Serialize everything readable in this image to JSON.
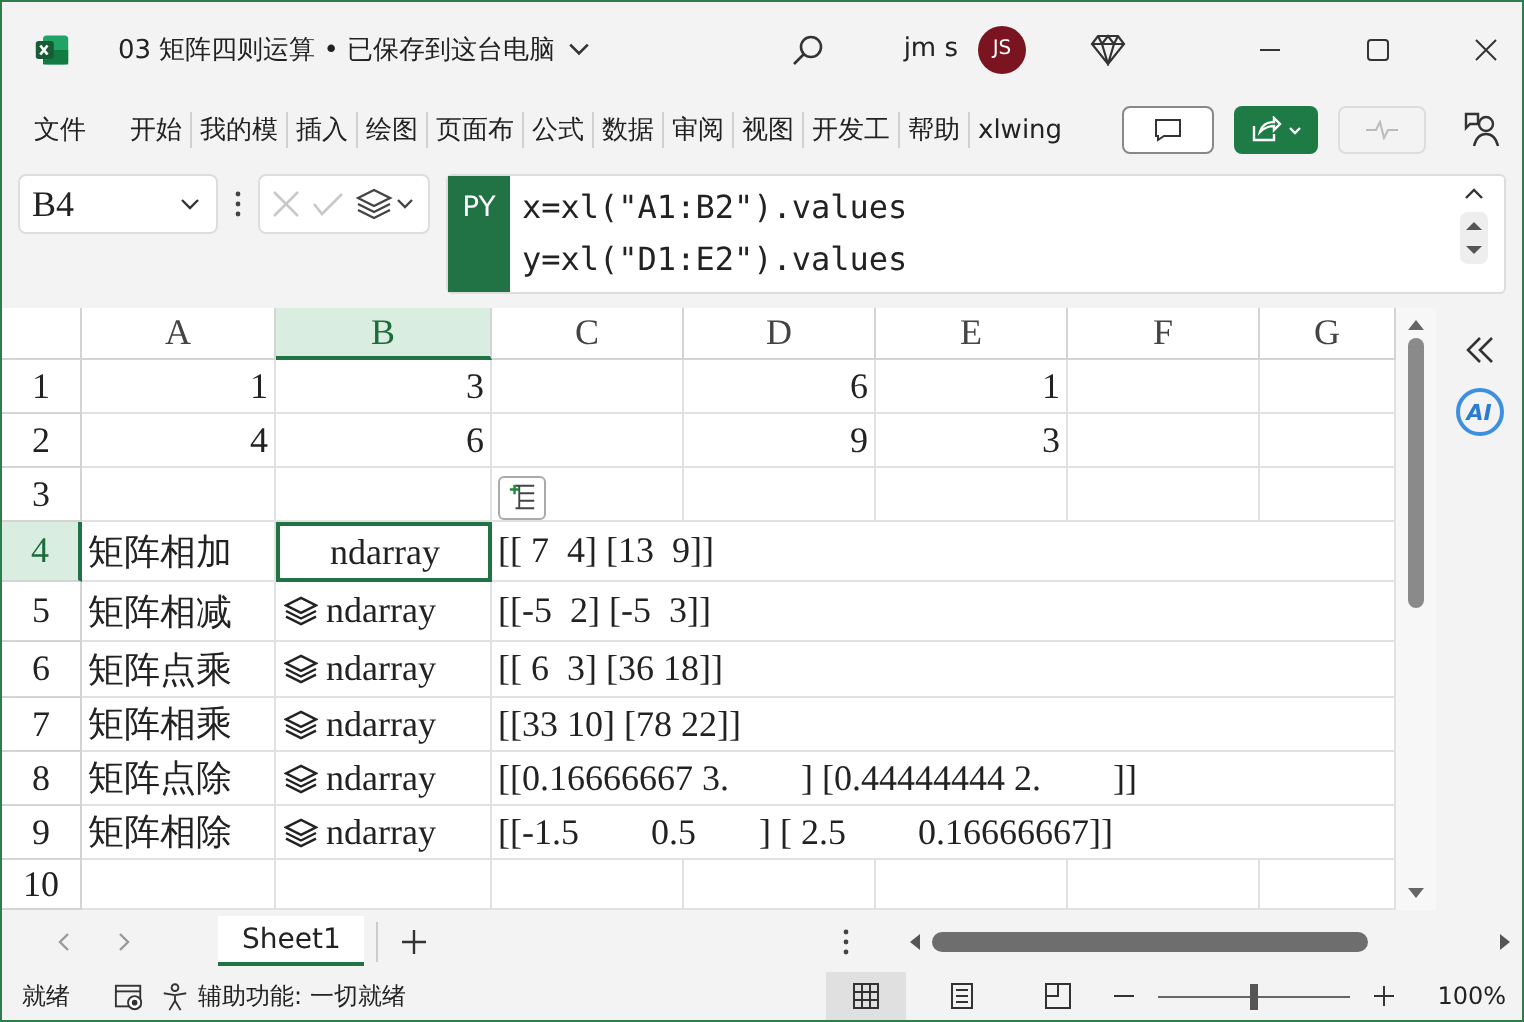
{
  "window": {
    "title": "03 矩阵四则运算 • 已保存到这台电脑",
    "user": "jm s",
    "avatar": "JS"
  },
  "ribbon_tabs": [
    {
      "label": "文件",
      "selected": false
    },
    {
      "label": "开始",
      "selected": false
    },
    {
      "label": "我的模",
      "selected": false
    },
    {
      "label": "插入",
      "selected": false
    },
    {
      "label": "绘图",
      "selected": false
    },
    {
      "label": "页面布",
      "selected": false
    },
    {
      "label": "公式",
      "selected": false
    },
    {
      "label": "数据",
      "selected": false
    },
    {
      "label": "审阅",
      "selected": false
    },
    {
      "label": "视图",
      "selected": false
    },
    {
      "label": "开发工",
      "selected": false
    },
    {
      "label": "帮助",
      "selected": false
    },
    {
      "label": "xlwing",
      "selected": false
    }
  ],
  "name_box": {
    "value": "B4"
  },
  "formula": {
    "badge": "PY",
    "lines": [
      "x=xl(\"A1:B2\").values",
      "y=xl(\"D1:E2\").values"
    ]
  },
  "side_pane": {
    "ai_label": "AI"
  },
  "columns": [
    {
      "label": "A",
      "selected": false
    },
    {
      "label": "B",
      "selected": true
    },
    {
      "label": "C",
      "selected": false
    },
    {
      "label": "D",
      "selected": false
    },
    {
      "label": "E",
      "selected": false
    },
    {
      "label": "F",
      "selected": false
    },
    {
      "label": "G",
      "selected": false
    }
  ],
  "rows": [
    {
      "label": "1",
      "selected": false,
      "cells": [
        {
          "kind": "number",
          "text": "1"
        },
        {
          "kind": "number",
          "text": "3"
        },
        {
          "kind": "empty"
        },
        {
          "kind": "number",
          "text": "6"
        },
        {
          "kind": "number",
          "text": "1"
        },
        {
          "kind": "empty"
        },
        {
          "kind": "empty"
        }
      ]
    },
    {
      "label": "2",
      "selected": false,
      "cells": [
        {
          "kind": "number",
          "text": "4"
        },
        {
          "kind": "number",
          "text": "6"
        },
        {
          "kind": "empty"
        },
        {
          "kind": "number",
          "text": "9"
        },
        {
          "kind": "number",
          "text": "3"
        },
        {
          "kind": "empty"
        },
        {
          "kind": "empty"
        }
      ]
    },
    {
      "label": "3",
      "selected": false,
      "cells": [
        {
          "kind": "empty"
        },
        {
          "kind": "empty"
        },
        {
          "kind": "insert-button"
        },
        {
          "kind": "empty"
        },
        {
          "kind": "empty"
        },
        {
          "kind": "empty"
        },
        {
          "kind": "empty"
        }
      ]
    },
    {
      "label": "4",
      "selected": true,
      "cells": [
        {
          "kind": "text",
          "text": "矩阵相加"
        },
        {
          "kind": "py-object",
          "text": "ndarray",
          "icon": false
        },
        {
          "kind": "text",
          "text": "[[ 7  4] [13  9]]"
        },
        {
          "kind": "empty"
        },
        {
          "kind": "empty"
        },
        {
          "kind": "empty"
        },
        {
          "kind": "empty"
        }
      ]
    },
    {
      "label": "5",
      "selected": false,
      "cells": [
        {
          "kind": "text",
          "text": "矩阵相减"
        },
        {
          "kind": "py-object",
          "text": "ndarray",
          "icon": true
        },
        {
          "kind": "text",
          "text": "[[-5  2] [-5  3]]"
        },
        {
          "kind": "empty"
        },
        {
          "kind": "empty"
        },
        {
          "kind": "empty"
        },
        {
          "kind": "empty"
        }
      ]
    },
    {
      "label": "6",
      "selected": false,
      "cells": [
        {
          "kind": "text",
          "text": "矩阵点乘"
        },
        {
          "kind": "py-object",
          "text": "ndarray",
          "icon": true
        },
        {
          "kind": "text",
          "text": "[[ 6  3] [36 18]]"
        },
        {
          "kind": "empty"
        },
        {
          "kind": "empty"
        },
        {
          "kind": "empty"
        },
        {
          "kind": "empty"
        }
      ]
    },
    {
      "label": "7",
      "selected": false,
      "cells": [
        {
          "kind": "text",
          "text": "矩阵相乘"
        },
        {
          "kind": "py-object",
          "text": "ndarray",
          "icon": true
        },
        {
          "kind": "text",
          "text": "[[33 10] [78 22]]"
        },
        {
          "kind": "empty"
        },
        {
          "kind": "empty"
        },
        {
          "kind": "empty"
        },
        {
          "kind": "empty"
        }
      ]
    },
    {
      "label": "8",
      "selected": false,
      "cells": [
        {
          "kind": "text",
          "text": "矩阵点除"
        },
        {
          "kind": "py-object",
          "text": "ndarray",
          "icon": true
        },
        {
          "kind": "text",
          "text": "[[0.16666667 3.        ] [0.44444444 2.        ]]"
        },
        {
          "kind": "empty"
        },
        {
          "kind": "empty"
        },
        {
          "kind": "empty"
        },
        {
          "kind": "empty"
        }
      ]
    },
    {
      "label": "9",
      "selected": false,
      "cells": [
        {
          "kind": "text",
          "text": "矩阵相除"
        },
        {
          "kind": "py-object",
          "text": "ndarray",
          "icon": true
        },
        {
          "kind": "text",
          "text": "[[-1.5        0.5       ] [ 2.5        0.16666667]]"
        },
        {
          "kind": "empty"
        },
        {
          "kind": "empty"
        },
        {
          "kind": "empty"
        },
        {
          "kind": "empty"
        }
      ]
    },
    {
      "label": "10",
      "selected": false,
      "cells": [
        {
          "kind": "empty"
        },
        {
          "kind": "empty"
        },
        {
          "kind": "empty"
        },
        {
          "kind": "empty"
        },
        {
          "kind": "empty"
        },
        {
          "kind": "empty"
        },
        {
          "kind": "empty"
        }
      ]
    }
  ],
  "sheet_tabs": [
    {
      "label": "Sheet1",
      "selected": true
    }
  ],
  "status_bar": {
    "ready": "就绪",
    "accessibility": "辅助功能: 一切就绪",
    "views": [
      {
        "kind": "normal",
        "selected": true
      },
      {
        "kind": "page-layout",
        "selected": false
      },
      {
        "kind": "page-break",
        "selected": false
      }
    ],
    "zoom": {
      "level": 0.5,
      "reading": "100%"
    }
  }
}
